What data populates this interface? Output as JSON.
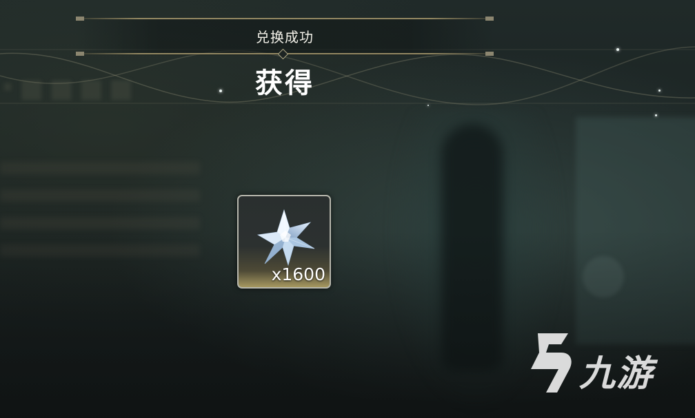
{
  "header": {
    "exchange_status": "兑换成功",
    "obtained_label": "获得"
  },
  "reward": {
    "icon": "crystal-star-icon",
    "quantity": "x1600"
  },
  "watermark": {
    "text": "九游"
  },
  "colors": {
    "gold_line": "#aa9b6e",
    "card_border": "#b7b7ad",
    "card_glow": "#a69860",
    "text": "#ffffff"
  }
}
